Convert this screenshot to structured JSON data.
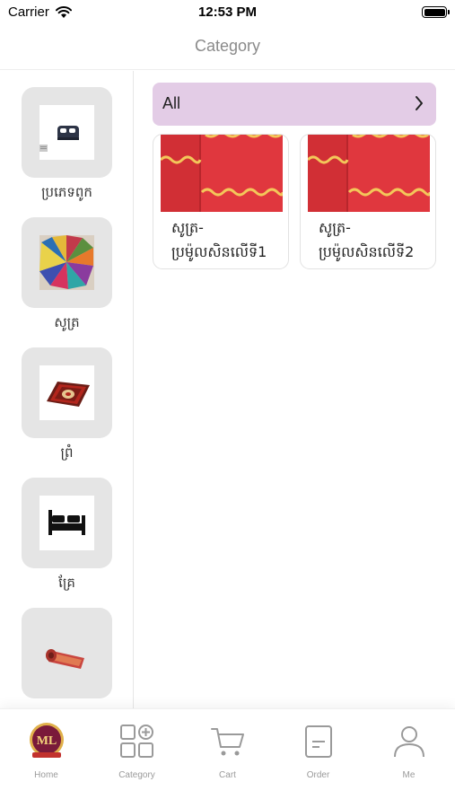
{
  "status_bar": {
    "carrier": "Carrier",
    "time": "12:53 PM"
  },
  "nav": {
    "title": "Category"
  },
  "sidebar": {
    "items": [
      {
        "label": "ប្រភេទពូក",
        "icon": "mattress-icon"
      },
      {
        "label": "សូត្រ",
        "icon": "silk-fan-icon"
      },
      {
        "label": "ព្រំ",
        "icon": "carpet-icon"
      },
      {
        "label": "គ្រែ",
        "icon": "bed-icon"
      },
      {
        "label": "",
        "icon": "rolled-rug-icon"
      }
    ]
  },
  "main": {
    "all_label": "All",
    "products": [
      {
        "name": "សូត្រ-ប្រម៉ូលសិនលើទី1"
      },
      {
        "name": "សូត្រ-ប្រម៉ូលសិនលើទី2"
      }
    ]
  },
  "tabs": [
    {
      "label": "Home",
      "icon": "ml-logo-icon"
    },
    {
      "label": "Category",
      "icon": "category-grid-icon"
    },
    {
      "label": "Cart",
      "icon": "cart-icon"
    },
    {
      "label": "Order",
      "icon": "order-icon"
    },
    {
      "label": "Me",
      "icon": "person-icon"
    }
  ],
  "colors": {
    "all_bar": "#e3cce6",
    "product_red": "#e0373e",
    "product_wave": "#f3c75a",
    "tab_inactive": "#9a9a9a"
  }
}
